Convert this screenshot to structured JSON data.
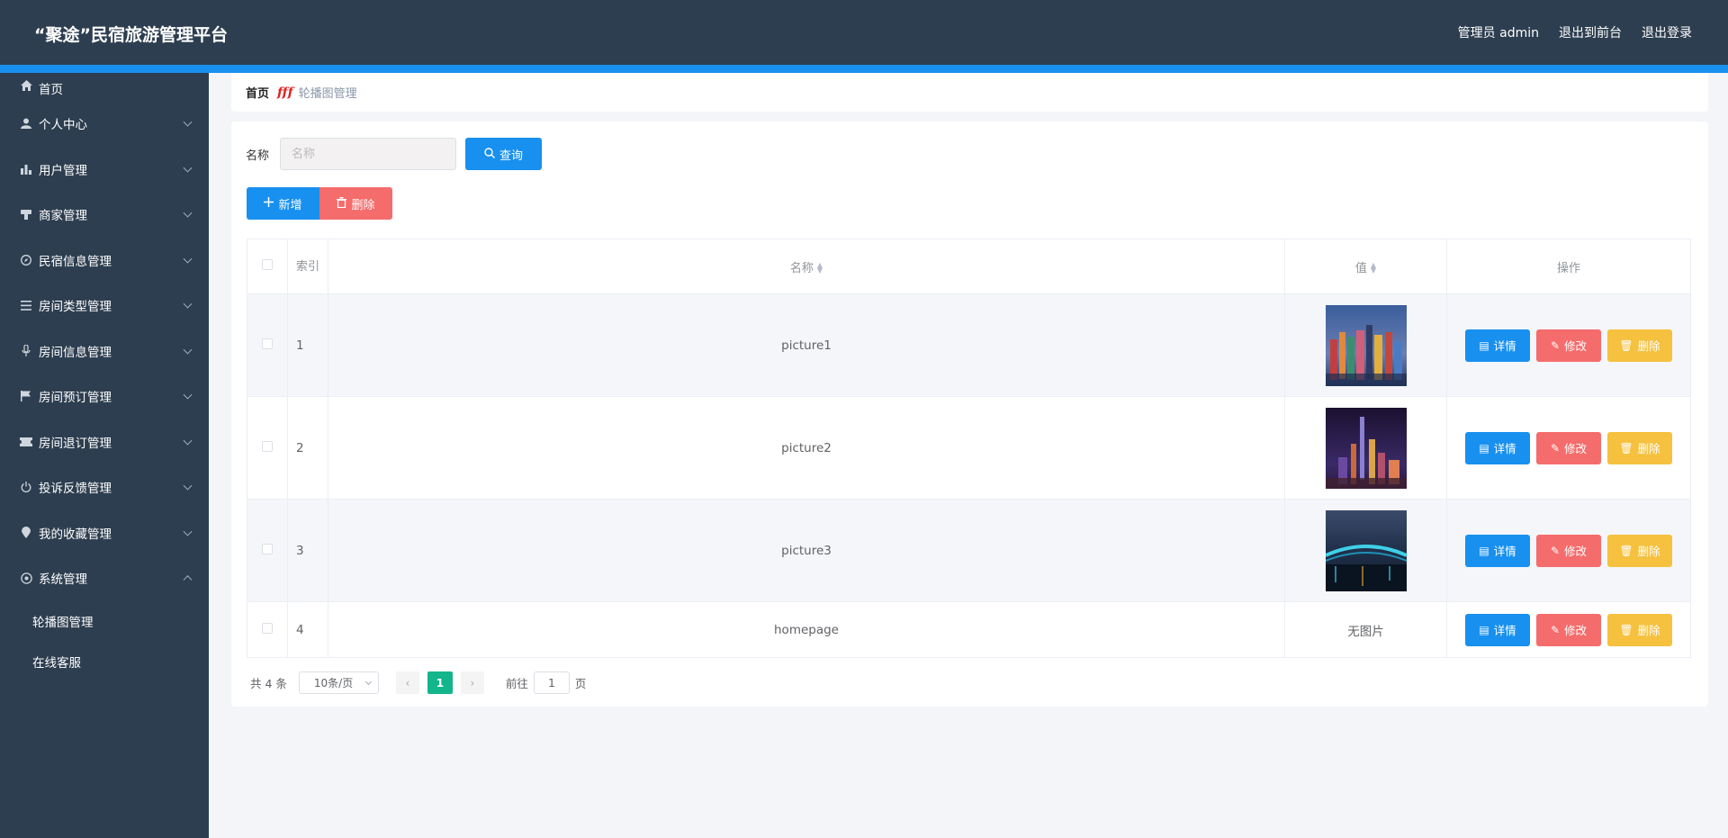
{
  "header": {
    "title": "“聚途”民宿旅游管理平台",
    "admin": "管理员 admin",
    "to_front": "退出到前台",
    "logout": "退出登录"
  },
  "sidebar": {
    "items": [
      {
        "label": "首页",
        "icon": "home-icon"
      },
      {
        "label": "个人中心",
        "icon": "user-icon"
      },
      {
        "label": "用户管理",
        "icon": "bar-chart-icon"
      },
      {
        "label": "商家管理",
        "icon": "shop-icon"
      },
      {
        "label": "民宿信息管理",
        "icon": "compass-icon"
      },
      {
        "label": "房间类型管理",
        "icon": "list-icon"
      },
      {
        "label": "房间信息管理",
        "icon": "microphone-icon"
      },
      {
        "label": "房间预订管理",
        "icon": "flag-icon"
      },
      {
        "label": "房间退订管理",
        "icon": "ticket-icon"
      },
      {
        "label": "投诉反馈管理",
        "icon": "power-icon"
      },
      {
        "label": "我的收藏管理",
        "icon": "location-icon"
      },
      {
        "label": "系统管理",
        "icon": "gear-icon"
      }
    ],
    "submenu": [
      "轮播图管理",
      "在线客服"
    ]
  },
  "breadcrumb": {
    "home": "首页",
    "sep": "fff",
    "current": "轮播图管理"
  },
  "search": {
    "label": "名称",
    "placeholder": "名称",
    "query": "查询"
  },
  "actions": {
    "add": "新增",
    "delete": "删除"
  },
  "table": {
    "headers": {
      "index": "索引",
      "name": "名称",
      "value": "值",
      "ops": "操作"
    },
    "rows": [
      {
        "index": "1",
        "name": "picture1",
        "value": "image",
        "image": "city-skyline-thumbnail"
      },
      {
        "index": "2",
        "name": "picture2",
        "value": "image",
        "image": "night-tower-thumbnail"
      },
      {
        "index": "3",
        "name": "picture3",
        "value": "image",
        "image": "bridge-night-thumbnail"
      },
      {
        "index": "4",
        "name": "homepage",
        "value": "无图片",
        "image": ""
      }
    ],
    "ops": {
      "detail": "详情",
      "edit": "修改",
      "remove": "删除"
    }
  },
  "pagination": {
    "total": "共 4 条",
    "page_size": "10条/页",
    "current": "1",
    "goto_prefix": "前往",
    "goto_value": "1",
    "goto_suffix": "页"
  },
  "colors": {
    "header_bg": "#2d3e50",
    "accent": "#1890ef",
    "danger": "#f56c6c",
    "warning": "#f5c13e",
    "page_active": "#13b58a"
  }
}
